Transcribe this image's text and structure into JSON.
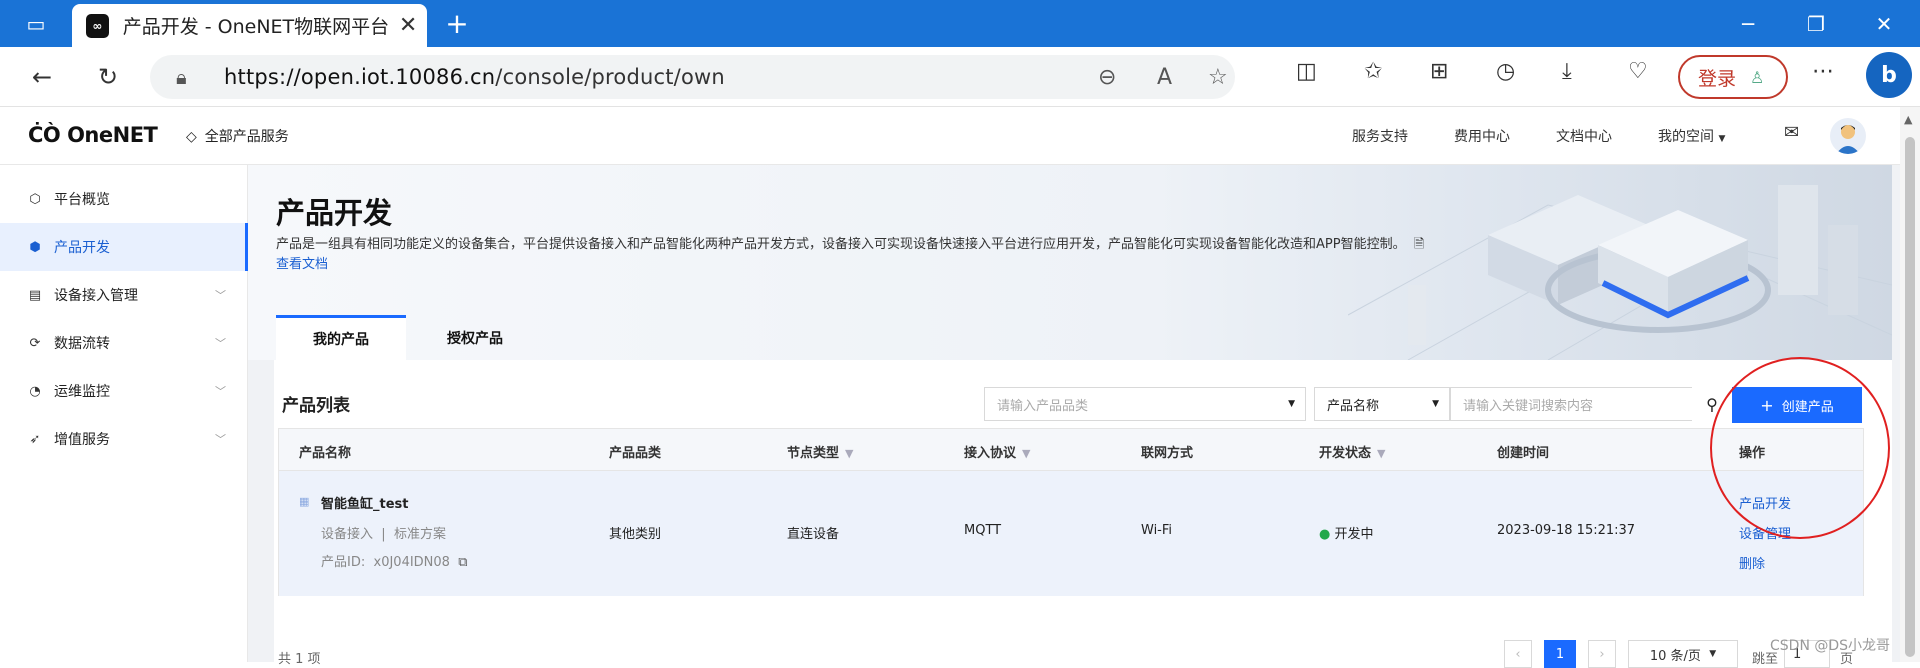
{
  "browser": {
    "tab_title": "产品开发 - OneNET物联网平台",
    "url_host": "https://open.iot.10086.cn",
    "url_path": "/console/product/own",
    "login_label": "登录"
  },
  "header": {
    "logo": "OneNET",
    "all_services": "全部产品服务",
    "links": [
      "服务支持",
      "费用中心",
      "文档中心",
      "我的空间"
    ]
  },
  "sidebar": {
    "items": [
      {
        "label": "平台概览",
        "icon": "overview-icon"
      },
      {
        "label": "产品开发",
        "icon": "cube-icon"
      },
      {
        "label": "设备接入管理",
        "icon": "device-icon"
      },
      {
        "label": "数据流转",
        "icon": "dataflow-icon"
      },
      {
        "label": "运维监控",
        "icon": "monitor-icon"
      },
      {
        "label": "增值服务",
        "icon": "rocket-icon"
      }
    ]
  },
  "page": {
    "title": "产品开发",
    "description": "产品是一组具有相同功能定义的设备集合，平台提供设备接入和产品智能化两种产品开发方式，设备接入可实现设备快速接入平台进行应用开发，产品智能化可实现设备智能化改造和APP智能控制。",
    "doc_link": "查看文档",
    "tabs": [
      "我的产品",
      "授权产品"
    ]
  },
  "list": {
    "title": "产品列表",
    "category_placeholder": "请输入产品品类",
    "field_select": "产品名称",
    "search_placeholder": "请输入关键词搜索内容",
    "create_button": "创建产品",
    "columns": [
      "产品名称",
      "产品品类",
      "节点类型",
      "接入协议",
      "联网方式",
      "开发状态",
      "创建时间",
      "操作"
    ],
    "rows": [
      {
        "name": "智能鱼缸_test",
        "access_type": "设备接入",
        "separator": "|",
        "scheme": "标准方案",
        "id_label": "产品ID:",
        "id_value": "x0J04IDN08",
        "category": "其他类别",
        "node_type": "直连设备",
        "protocol": "MQTT",
        "network": "Wi-Fi",
        "status": "开发中",
        "created": "2023-09-18 15:21:37",
        "actions": [
          "产品开发",
          "设备管理",
          "删除"
        ]
      }
    ],
    "total": "共 1 项",
    "page_current": "1",
    "page_size": "10 条/页",
    "jump_label": "跳至",
    "jump_value": "1",
    "jump_suffix": "页"
  },
  "watermark": "CSDN @DS小龙哥"
}
